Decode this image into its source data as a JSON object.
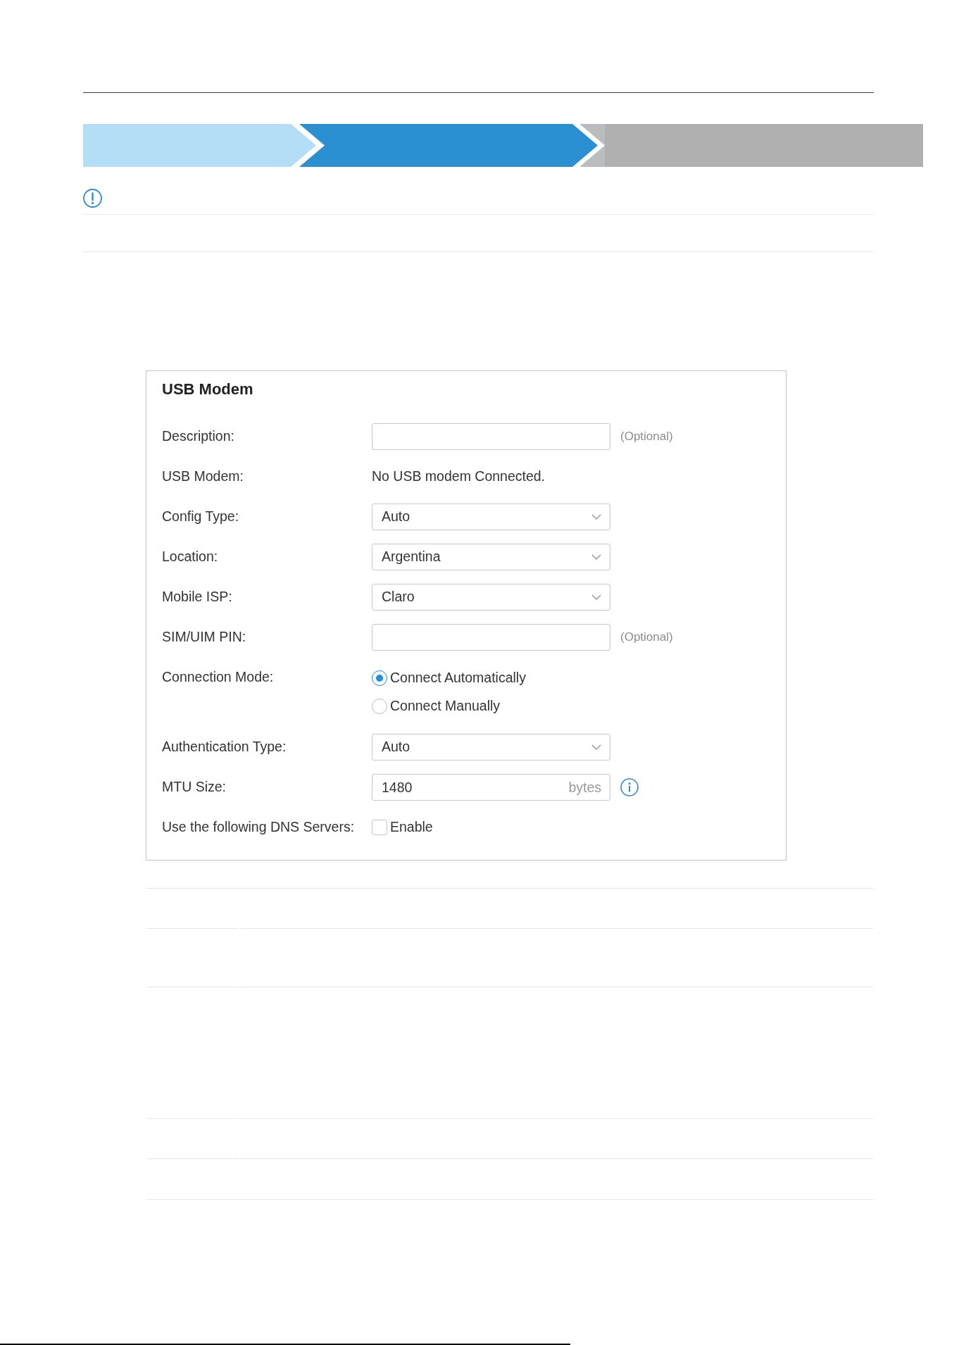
{
  "steps": [
    {
      "completed": true,
      "selected": false
    },
    {
      "selected": true
    },
    {
      "completed": false,
      "selected": false
    }
  ],
  "usb_modem_form": {
    "title": "USB Modem",
    "fields": [
      {
        "kind": "input",
        "label": "Description:",
        "note": "(Optional)"
      },
      {
        "kind": "static",
        "label": "USB Modem:",
        "value": "No USB modem Connected."
      },
      {
        "kind": "select",
        "label": "Config Type:",
        "value": "Auto"
      },
      {
        "kind": "select",
        "label": "Location:",
        "value": "Argentina"
      },
      {
        "kind": "select",
        "label": "Mobile ISP:",
        "value": "Claro"
      },
      {
        "kind": "input",
        "label": "SIM/UIM PIN:",
        "note": "(Optional)"
      },
      {
        "kind": "radio",
        "label": "Connection Mode:",
        "options": [
          {
            "label": "Connect Automatically",
            "selected": true
          },
          {
            "label": "Connect Manually",
            "selected": false
          }
        ]
      },
      {
        "kind": "select",
        "label": "Authentication Type:",
        "value": "Auto"
      },
      {
        "kind": "input",
        "label": "MTU Size:",
        "value": "1480",
        "unit": "bytes",
        "info": true
      },
      {
        "kind": "checkbox",
        "label": "Use the following DNS Servers:",
        "option": "Enable",
        "checked": false
      }
    ]
  }
}
